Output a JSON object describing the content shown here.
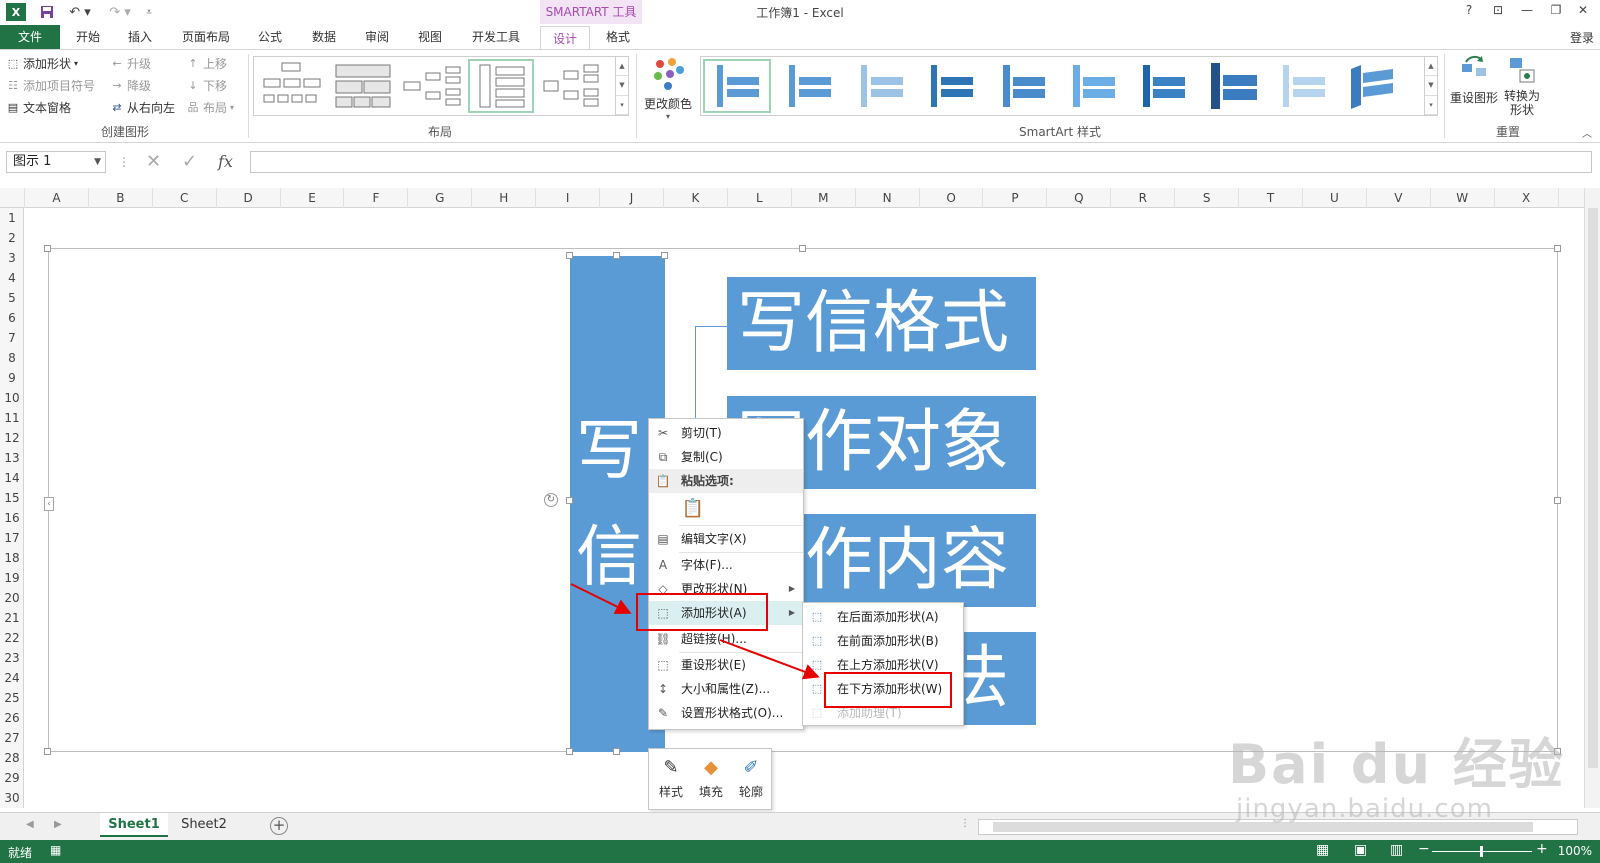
{
  "window": {
    "title": "工作簿1 - Excel",
    "contextual_tab_label": "SMARTART 工具",
    "help": "?",
    "login": "登录"
  },
  "tabs": [
    "文件",
    "开始",
    "插入",
    "页面布局",
    "公式",
    "数据",
    "审阅",
    "视图",
    "开发工具",
    "设计",
    "格式"
  ],
  "ribbon": {
    "create_group": {
      "label": "创建图形",
      "add_shape": "添加形状",
      "add_bullet": "添加项目符号",
      "text_pane": "文本窗格",
      "promote": "升级",
      "demote": "降级",
      "right_to_left": "从右向左",
      "move_up": "上移",
      "move_down": "下移",
      "layout": "布局"
    },
    "layout_group": {
      "label": "布局"
    },
    "styles_group": {
      "label": "SmartArt 样式",
      "change_colors": "更改颜色"
    },
    "reset_group": {
      "label": "重置",
      "reset_graphic": "重设图形",
      "convert_line1": "转换为",
      "convert_line2": "形状"
    }
  },
  "formula_bar": {
    "name_box": "图示 1",
    "fx": "fx",
    "value": ""
  },
  "columns": [
    "A",
    "B",
    "C",
    "D",
    "E",
    "F",
    "G",
    "H",
    "I",
    "J",
    "K",
    "L",
    "M",
    "N",
    "O",
    "P",
    "Q",
    "R",
    "S",
    "T",
    "U",
    "V",
    "W",
    "X"
  ],
  "rows": [
    "1",
    "2",
    "3",
    "4",
    "5",
    "6",
    "7",
    "8",
    "9",
    "10",
    "11",
    "12",
    "13",
    "14",
    "15",
    "16",
    "17",
    "18",
    "19",
    "20",
    "21",
    "22",
    "23",
    "24",
    "25",
    "26",
    "27",
    "28",
    "29",
    "30"
  ],
  "smartart": {
    "main_text": "写信",
    "items": [
      "写信格式",
      "写作对象",
      "写作内容",
      "写作方法"
    ]
  },
  "context_menu": {
    "items": [
      {
        "label": "剪切(T)",
        "icon": "scissors-icon"
      },
      {
        "label": "复制(C)",
        "icon": "copy-icon"
      },
      {
        "label": "粘贴选项:",
        "icon": "paste-icon"
      },
      {
        "label": "编辑文字(X)",
        "icon": "text-edit-icon"
      },
      {
        "label": "字体(F)...",
        "icon": "font-icon"
      },
      {
        "label": "更改形状(N)",
        "icon": "change-shape-icon"
      },
      {
        "label": "添加形状(A)",
        "icon": "add-shape-icon"
      },
      {
        "label": "超链接(H)...",
        "icon": "link-icon"
      },
      {
        "label": "重设形状(E)",
        "icon": "reset-shape-icon"
      },
      {
        "label": "大小和属性(Z)...",
        "icon": "size-icon"
      },
      {
        "label": "设置形状格式(O)...",
        "icon": "format-shape-icon"
      }
    ],
    "submenu": [
      {
        "label": "在后面添加形状(A)",
        "icon": "add-after-icon"
      },
      {
        "label": "在前面添加形状(B)",
        "icon": "add-before-icon"
      },
      {
        "label": "在上方添加形状(V)",
        "icon": "add-above-icon"
      },
      {
        "label": "在下方添加形状(W)",
        "icon": "add-below-icon"
      },
      {
        "label": "添加助理(T)",
        "icon": "add-assistant-icon"
      }
    ]
  },
  "mini_toolbar": [
    "样式",
    "填充",
    "轮廓"
  ],
  "sheets": [
    "Sheet1",
    "Sheet2"
  ],
  "status": {
    "text": "就绪",
    "zoom": "100%"
  },
  "watermark": {
    "main": "Bai du 经验",
    "sub": "jingyan.baidu.com"
  },
  "colors": {
    "accent": "#217346",
    "smartart_fill": "#5b9bd5",
    "annotation": "#e60000",
    "contextual": "#a94bb2"
  }
}
